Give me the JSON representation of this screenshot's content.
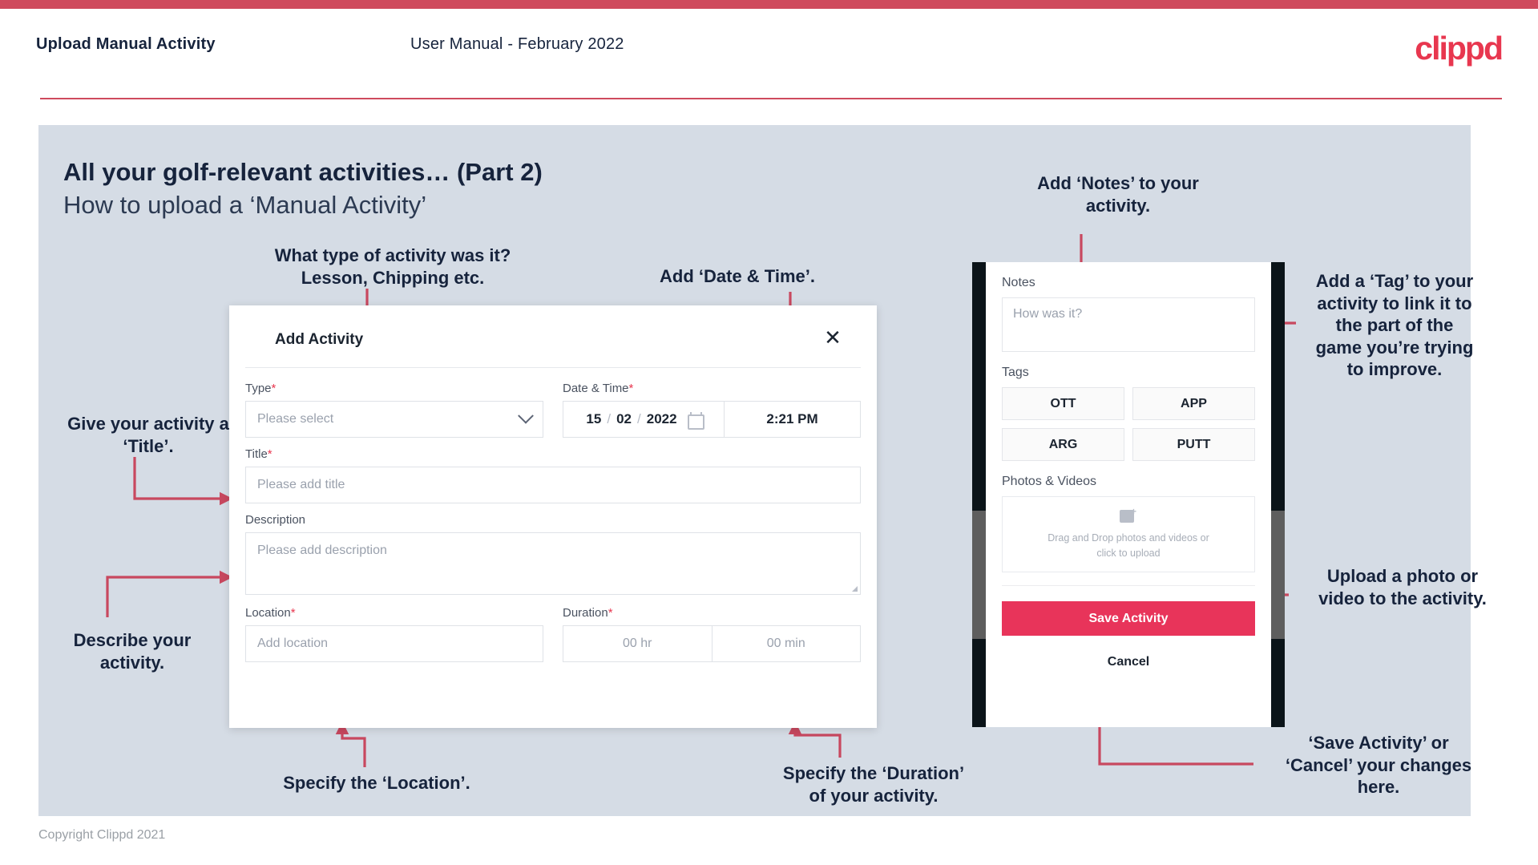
{
  "header": {
    "left_title": "Upload Manual Activity",
    "center_title": "User Manual - February 2022",
    "logo_text": "clippd"
  },
  "slide": {
    "title_line1": "All your golf-relevant activities… (Part 2)",
    "title_line2": "How to upload a ‘Manual Activity’"
  },
  "annotations": {
    "type": "What type of activity was it?\nLesson, Chipping etc.",
    "type_l1": "What type of activity was it?",
    "type_l2": "Lesson, Chipping etc.",
    "datetime": "Add ‘Date & Time’.",
    "title_l1": "Give your activity a",
    "title_l2": "‘Title’.",
    "describe_l1": "Describe your",
    "describe_l2": "activity.",
    "location": "Specify the ‘Location’.",
    "duration_l1": "Specify the ‘Duration’",
    "duration_l2": "of your activity.",
    "notes_l1": "Add ‘Notes’ to your",
    "notes_l2": "activity.",
    "tag_l1": "Add a ‘Tag’ to your",
    "tag_l2": "activity to link it to",
    "tag_l3": "the part of the",
    "tag_l4": "game you’re trying",
    "tag_l5": "to improve.",
    "upload_l1": "Upload a photo or",
    "upload_l2": "video to the activity.",
    "savecancel_l1": "‘Save Activity’ or",
    "savecancel_l2": "‘Cancel’ your changes",
    "savecancel_l3": "here."
  },
  "dialog": {
    "title": "Add Activity",
    "close_icon": "close-icon",
    "fields": {
      "type_label": "Type",
      "type_required": "*",
      "type_placeholder": "Please select",
      "datetime_label": "Date & Time",
      "datetime_required": "*",
      "date_day": "15",
      "date_month": "02",
      "date_year": "2022",
      "date_sep": "/",
      "calendar_icon": "calendar-icon",
      "time_value": "2:21 PM",
      "title_label": "Title",
      "title_required": "*",
      "title_placeholder": "Please add title",
      "description_label": "Description",
      "description_placeholder": "Please add description",
      "location_label": "Location",
      "location_required": "*",
      "location_placeholder": "Add location",
      "duration_label": "Duration",
      "duration_required": "*",
      "duration_hours_placeholder": "00 hr",
      "duration_minutes_placeholder": "00 min"
    }
  },
  "phone": {
    "notes_label": "Notes",
    "notes_placeholder": "How was it?",
    "tags_label": "Tags",
    "tags": [
      "OTT",
      "APP",
      "ARG",
      "PUTT"
    ],
    "photos_label": "Photos & Videos",
    "dropzone_line1": "Drag and Drop photos and videos or",
    "dropzone_line2": "click to upload",
    "dropzone_icon": "image-add-icon",
    "save_label": "Save Activity",
    "cancel_label": "Cancel"
  },
  "footer": {
    "copyright": "Copyright Clippd 2021"
  },
  "colors": {
    "brand_red": "#e8374f",
    "accent_bar": "#cf4a5d",
    "slide_bg": "#d5dce5",
    "text_dark": "#16233c",
    "save_button": "#e8345a",
    "arrow": "#c8485f"
  }
}
